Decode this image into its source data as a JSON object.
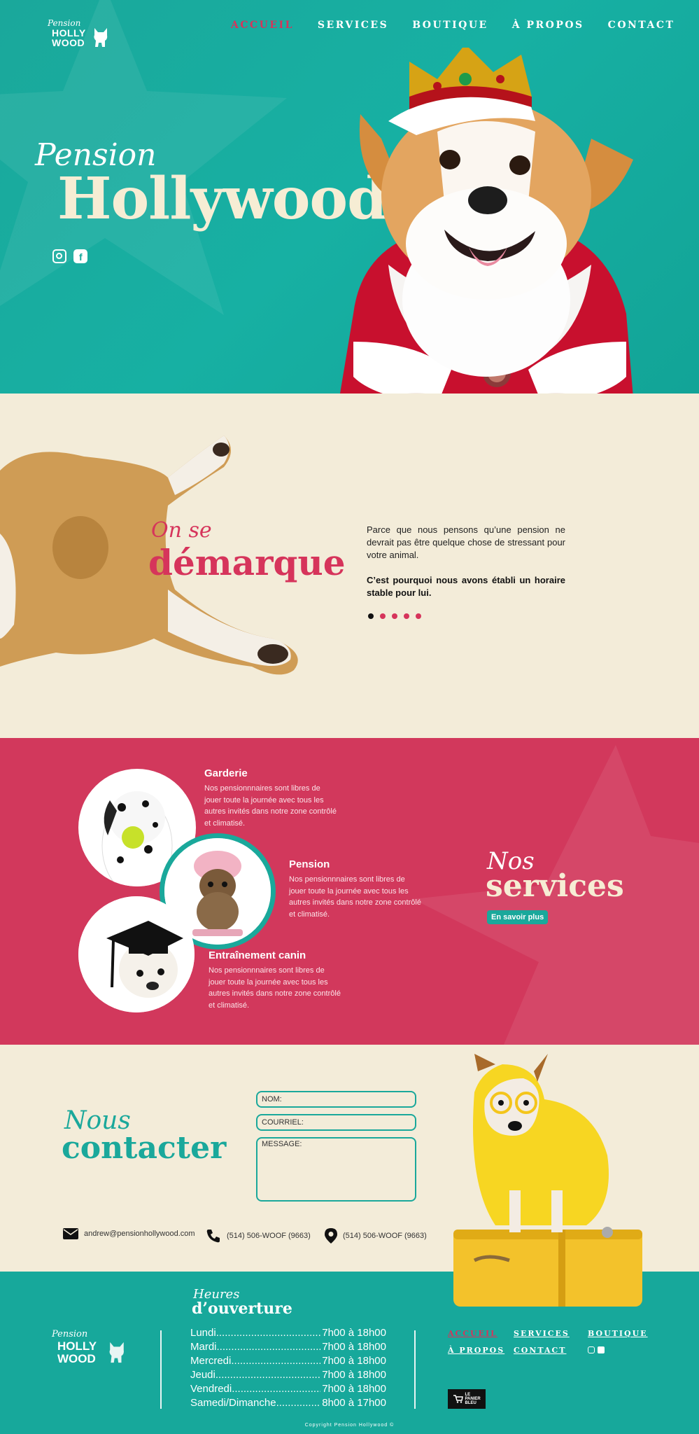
{
  "nav": {
    "logo": {
      "small": "Pension",
      "line1": "HOLLY",
      "line2": "WOOD"
    },
    "items": [
      "ACCUEIL",
      "SERVICES",
      "BOUTIQUE",
      "À PROPOS",
      "CONTACT"
    ]
  },
  "hero": {
    "script": "Pension",
    "title": "Hollywood",
    "social": [
      "instagram-icon",
      "facebook-icon"
    ]
  },
  "intro": {
    "script": "On se",
    "title": "démarque",
    "paragraph1": "Parce que nous pensons qu’une pension ne devrait pas être quelque chose de stressant pour votre animal.",
    "paragraph2": "C’est pourquoi nous avons établi un horaire stable pour lui.",
    "slides": 5,
    "active_slide": 1
  },
  "services": {
    "script": "Nos",
    "title": "services",
    "button": "En savoir plus",
    "items": [
      {
        "title": "Garderie",
        "text": "Nos pensionnnaires sont libres de jouer toute la journée avec tous les autres invités dans notre zone contrôlé et climatisé."
      },
      {
        "title": "Pension",
        "text": "Nos pensionnnaires sont libres de jouer toute la journée avec tous les autres invités dans notre zone contrôlé et climatisé."
      },
      {
        "title": "Entraînement canin",
        "text": "Nos pensionnnaires sont libres de jouer toute la journée avec tous les autres invités dans notre zone contrôlé et climatisé."
      }
    ]
  },
  "contact": {
    "script": "Nous",
    "title": "contacter",
    "fields": {
      "name": "NOM:",
      "email": "COURRIEL:",
      "message": "MESSAGE:"
    },
    "email": "andrew@pensionhollywood.com",
    "phone": "(514) 506-WOOF (9663)",
    "address": "(514) 506-WOOF (9663)"
  },
  "footer": {
    "logo": {
      "small": "Pension",
      "line1": "HOLLY",
      "line2": "WOOD"
    },
    "hours_script": "Heures",
    "hours_title": "d’ouverture",
    "hours": [
      {
        "day": "Lundi",
        "time": "7h00 à 18h00"
      },
      {
        "day": "Mardi",
        "time": "7h00 à 18h00"
      },
      {
        "day": "Mercredi",
        "time": "7h00 à 18h00"
      },
      {
        "day": "Jeudi",
        "time": "7h00 à 18h00"
      },
      {
        "day": "Vendredi",
        "time": "7h00 à 18h00"
      },
      {
        "day": "Samedi/Dimanche",
        "time": "8h00 à 17h00"
      }
    ],
    "nav": [
      "ACCUEIL",
      "SERVICES",
      "BOUTIQUE",
      "À PROPOS",
      "CONTACT"
    ],
    "badge": "LE PANIER BLEU",
    "copyright": "Copyright Pension Hollywood ©"
  },
  "colors": {
    "teal": "#1aa89b",
    "pink": "#d2385c",
    "cream": "#f3ecd9"
  }
}
